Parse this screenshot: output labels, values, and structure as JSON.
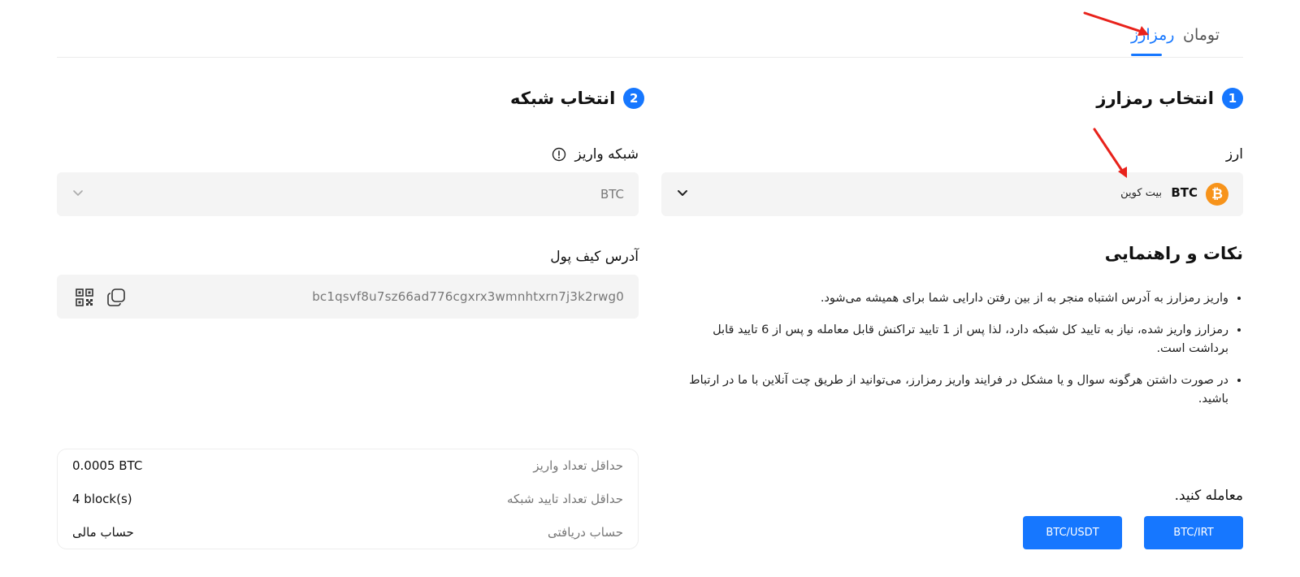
{
  "tabs": [
    {
      "label": "رمزارز",
      "active": true
    },
    {
      "label": "تومان",
      "active": false
    }
  ],
  "step1": {
    "number": "1",
    "title": "انتخاب رمزارز"
  },
  "step2": {
    "number": "2",
    "title": "انتخاب شبکه"
  },
  "currency": {
    "label": "ارز",
    "symbol": "BTC",
    "name": "بیت کوین",
    "icon": "bitcoin-icon"
  },
  "network": {
    "label": "شبکه واریز",
    "value": "BTC",
    "info_icon": "info-icon"
  },
  "wallet": {
    "label": "آدرس کیف پول",
    "address": "bc1qsvf8u7sz66ad776cgxrx3wmnhtxrn7j3k2rwg0",
    "copy_icon": "copy-icon",
    "qr_icon": "qr-code-icon"
  },
  "tips": {
    "title": "نکات و راهنمایی",
    "items": [
      "واریز رمزارز به آدرس اشتباه منجر به از بین رفتن دارایی شما برای همیشه می‌شود.",
      "رمزارز واریز شده، نیاز به تایید کل شبکه دارد، لذا پس از 1 تایید تراکنش قابل معامله و پس از 6 تایید قابل برداشت است.",
      "در صورت داشتن هرگونه سوال و یا مشکل در فرایند واریز رمزارز، می‌توانید از طریق  چت آنلاین  با ما در ارتباط باشید."
    ]
  },
  "info": {
    "rows": [
      {
        "label": "حداقل تعداد واریز",
        "value": "0.0005 BTC"
      },
      {
        "label": "حداقل تعداد تایید شبکه",
        "value": "4 block(s)"
      },
      {
        "label": "حساب دریافتی",
        "value": "حساب مالی"
      }
    ]
  },
  "trade": {
    "label": "معامله کنید.",
    "buttons": [
      "BTC/IRT",
      "BTC/USDT"
    ]
  },
  "colors": {
    "accent": "#1677ff",
    "bitcoin": "#f7931a",
    "annotation_arrow": "#e8221b"
  }
}
